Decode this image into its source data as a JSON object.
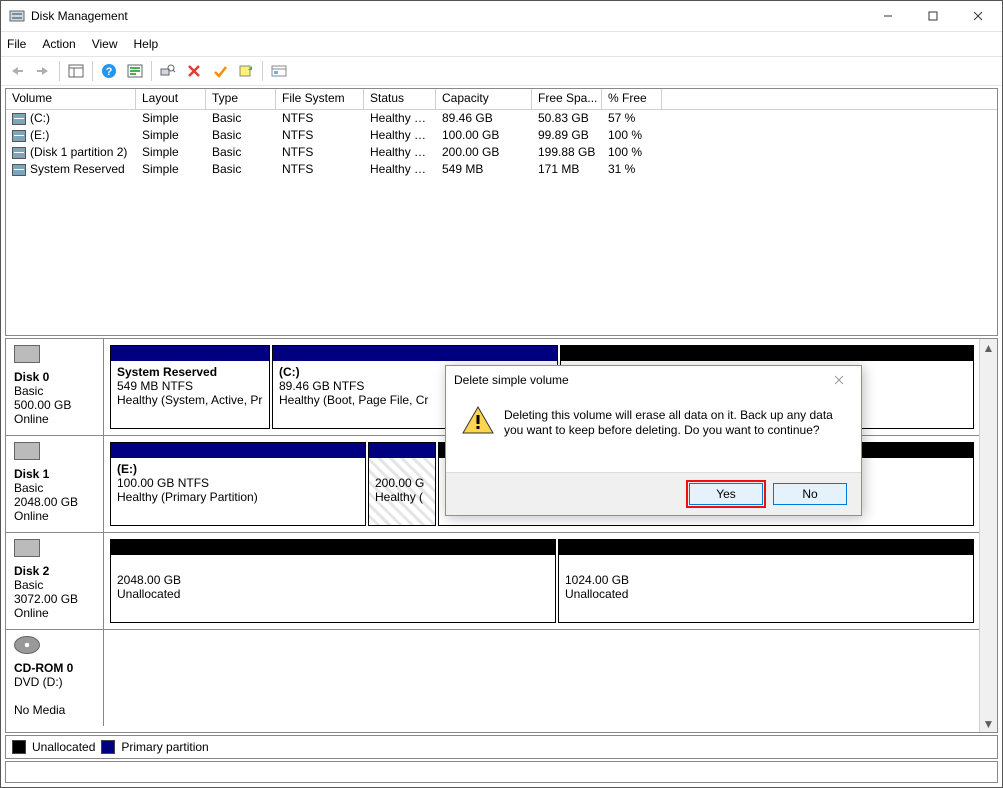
{
  "window": {
    "title": "Disk Management"
  },
  "menu": {
    "file": "File",
    "action": "Action",
    "view": "View",
    "help": "Help"
  },
  "columns": {
    "volume": "Volume",
    "layout": "Layout",
    "type": "Type",
    "fs": "File System",
    "status": "Status",
    "capacity": "Capacity",
    "free": "Free Spa...",
    "pct": "% Free"
  },
  "volumes": [
    {
      "name": "(C:)",
      "layout": "Simple",
      "type": "Basic",
      "fs": "NTFS",
      "status": "Healthy (B...",
      "capacity": "89.46 GB",
      "free": "50.83 GB",
      "pct": "57 %"
    },
    {
      "name": "(E:)",
      "layout": "Simple",
      "type": "Basic",
      "fs": "NTFS",
      "status": "Healthy (P...",
      "capacity": "100.00 GB",
      "free": "99.89 GB",
      "pct": "100 %"
    },
    {
      "name": "(Disk 1 partition 2)",
      "layout": "Simple",
      "type": "Basic",
      "fs": "NTFS",
      "status": "Healthy (P...",
      "capacity": "200.00 GB",
      "free": "199.88 GB",
      "pct": "100 %"
    },
    {
      "name": "System Reserved",
      "layout": "Simple",
      "type": "Basic",
      "fs": "NTFS",
      "status": "Healthy (S...",
      "capacity": "549 MB",
      "free": "171 MB",
      "pct": "31 %"
    }
  ],
  "disks": {
    "d0": {
      "name": "Disk 0",
      "type": "Basic",
      "size": "500.00 GB",
      "state": "Online",
      "p0": {
        "title": "System Reserved",
        "line2": "549 MB NTFS",
        "line3": "Healthy (System, Active, Pr"
      },
      "p1": {
        "title": "(C:)",
        "line2": "89.46 GB NTFS",
        "line3": "Healthy (Boot, Page File, Cr"
      }
    },
    "d1": {
      "name": "Disk 1",
      "type": "Basic",
      "size": "2048.00 GB",
      "state": "Online",
      "p0": {
        "title": "(E:)",
        "line2": "100.00 GB NTFS",
        "line3": "Healthy (Primary Partition)"
      },
      "p1": {
        "line2": "200.00 G",
        "line3": "Healthy ("
      }
    },
    "d2": {
      "name": "Disk 2",
      "type": "Basic",
      "size": "3072.00 GB",
      "state": "Online",
      "p0": {
        "line2": "2048.00 GB",
        "line3": "Unallocated"
      },
      "p1": {
        "line2": "1024.00 GB",
        "line3": "Unallocated"
      }
    },
    "cd": {
      "name": "CD-ROM 0",
      "type": "DVD (D:)",
      "state": "No Media"
    }
  },
  "legend": {
    "unalloc": "Unallocated",
    "primary": "Primary partition"
  },
  "dialog": {
    "title": "Delete simple volume",
    "text": "Deleting this volume will erase all data on it. Back up any data you want to keep before deleting. Do you want to continue?",
    "yes": "Yes",
    "no": "No"
  }
}
